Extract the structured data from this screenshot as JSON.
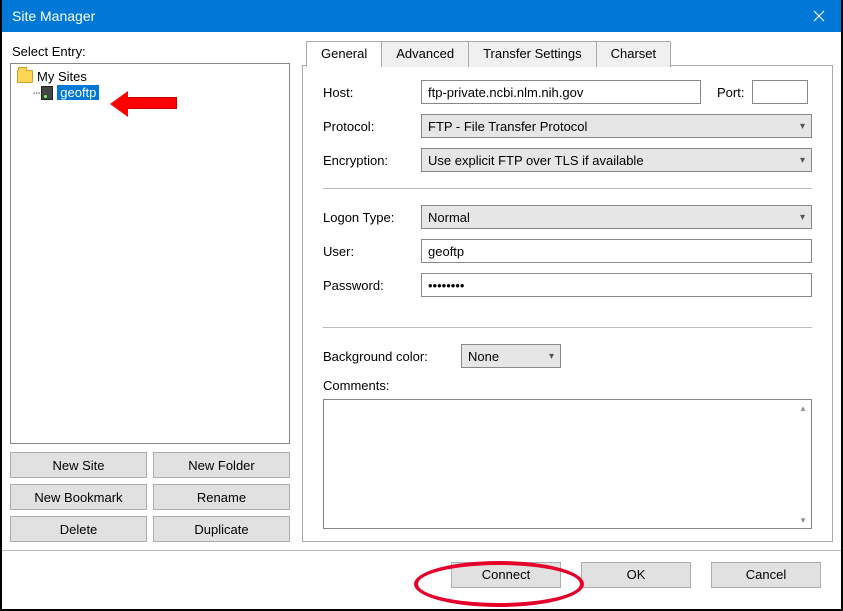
{
  "window": {
    "title": "Site Manager"
  },
  "left": {
    "entry_label": "Select Entry:",
    "folder": "My Sites",
    "site": "geoftp",
    "buttons": {
      "new_site": "New Site",
      "new_folder": "New Folder",
      "new_bookmark": "New Bookmark",
      "rename": "Rename",
      "delete": "Delete",
      "duplicate": "Duplicate"
    }
  },
  "tabs": {
    "general": "General",
    "advanced": "Advanced",
    "transfer": "Transfer Settings",
    "charset": "Charset"
  },
  "general": {
    "host_label": "Host:",
    "host_value": "ftp-private.ncbi.nlm.nih.gov",
    "port_label": "Port:",
    "port_value": "",
    "protocol_label": "Protocol:",
    "protocol_value": "FTP - File Transfer Protocol",
    "encryption_label": "Encryption:",
    "encryption_value": "Use explicit FTP over TLS if available",
    "logon_label": "Logon Type:",
    "logon_value": "Normal",
    "user_label": "User:",
    "user_value": "geoftp",
    "password_label": "Password:",
    "password_value": "••••••••",
    "bgcolor_label": "Background color:",
    "bgcolor_value": "None",
    "comments_label": "Comments:"
  },
  "footer": {
    "connect": "Connect",
    "ok": "OK",
    "cancel": "Cancel"
  }
}
